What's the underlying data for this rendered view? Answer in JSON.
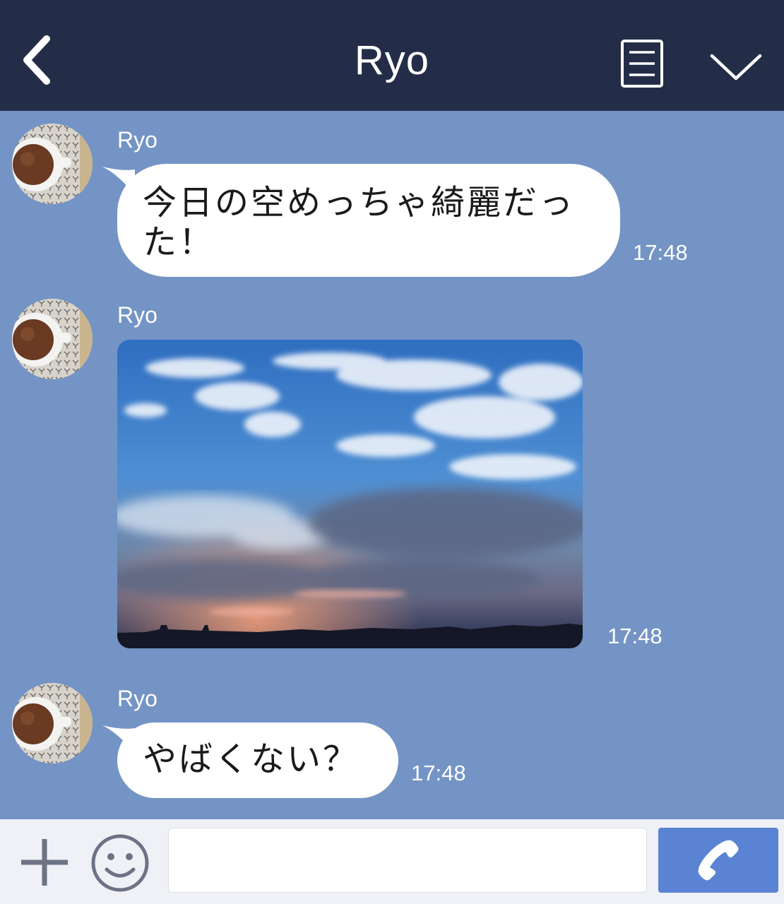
{
  "header": {
    "title": "Ryo",
    "back_icon": "chevron-left-icon",
    "menu_icon": "menu-list-icon",
    "collapse_icon": "chevron-down-icon"
  },
  "messages": [
    {
      "sender": "Ryo",
      "type": "text",
      "text_line1": "今日の空めっちゃ綺麗だっ",
      "text_line2": "た！",
      "time": "17:48"
    },
    {
      "sender": "Ryo",
      "type": "image",
      "image": "sky-photo",
      "time": "17:48"
    },
    {
      "sender": "Ryo",
      "type": "text",
      "text": "やばくない？",
      "time": "17:48"
    }
  ],
  "input_bar": {
    "add_icon": "plus-icon",
    "emoji_icon": "smiley-icon",
    "message_value": "",
    "placeholder": "",
    "send_icon": "phone-icon"
  },
  "colors": {
    "header_bg": "#242d48",
    "chat_bg": "#7494c5",
    "bubble_bg": "#ffffff",
    "send_button": "#5a83d4",
    "input_bar_bg": "#eff1f6"
  }
}
